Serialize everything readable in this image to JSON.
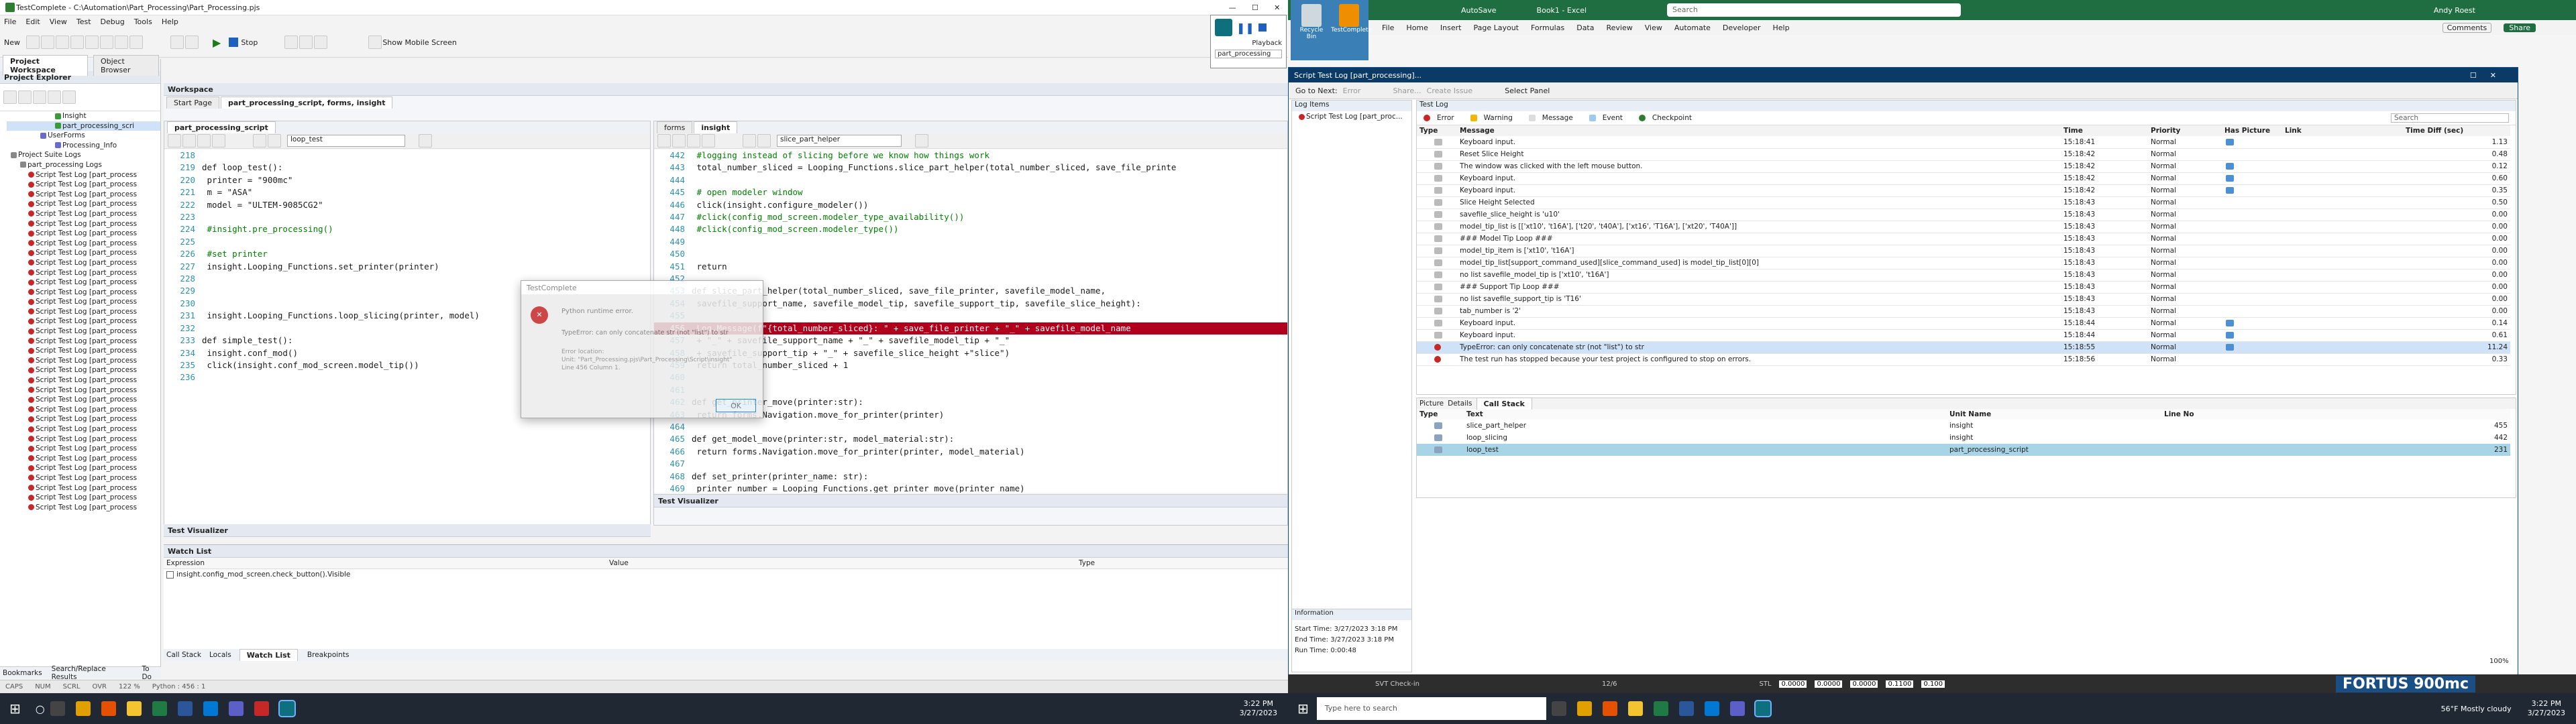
{
  "testcomplete": {
    "title": "TestComplete - C:\\Automation\\Part_Processing\\Part_Processing.pjs",
    "menu": [
      "File",
      "Edit",
      "View",
      "Test",
      "Debug",
      "Tools",
      "Help"
    ],
    "toolbar": {
      "new_label": "New",
      "stop_label": "Stop",
      "show_mobile_label": "Show Mobile Screen"
    },
    "project_explorer": {
      "tabs": [
        "Project Workspace",
        "Object Browser"
      ],
      "header": "Project Explorer",
      "tree": [
        "Insight",
        "part_processing_scri",
        "UserForms",
        "Processing_Info",
        "Project Suite Logs",
        "part_processing Logs"
      ],
      "log_items": [
        "Script Test Log [part_process",
        "Script Test Log [part_process",
        "Script Test Log [part_process",
        "Script Test Log [part_process",
        "Script Test Log [part_process",
        "Script Test Log [part_process",
        "Script Test Log [part_process",
        "Script Test Log [part_process",
        "Script Test Log [part_process",
        "Script Test Log [part_process",
        "Script Test Log [part_process",
        "Script Test Log [part_process",
        "Script Test Log [part_process",
        "Script Test Log [part_process",
        "Script Test Log [part_process",
        "Script Test Log [part_process",
        "Script Test Log [part_process",
        "Script Test Log [part_process",
        "Script Test Log [part_process",
        "Script Test Log [part_process",
        "Script Test Log [part_process",
        "Script Test Log [part_process",
        "Script Test Log [part_process",
        "Script Test Log [part_process",
        "Script Test Log [part_process",
        "Script Test Log [part_process",
        "Script Test Log [part_process",
        "Script Test Log [part_process",
        "Script Test Log [part_process",
        "Script Test Log [part_process",
        "Script Test Log [part_process",
        "Script Test Log [part_process",
        "Script Test Log [part_process",
        "Script Test Log [part_process",
        "Script Test Log [part_process"
      ],
      "bottom_tabs": [
        "Bookmarks",
        "Search/Replace Results",
        "To Do"
      ]
    },
    "workspace": {
      "header": "Workspace",
      "tabs": [
        "Start Page",
        "part_processing_script, forms, insight"
      ],
      "left_editor": {
        "tab": "part_processing_script",
        "routine": "loop_test",
        "lines": [
          {
            "n": "218",
            "t": ""
          },
          {
            "n": "219",
            "t": "def loop_test():"
          },
          {
            "n": "220",
            "t": "  printer = \"900mc\""
          },
          {
            "n": "221",
            "t": "  m = \"ASA\""
          },
          {
            "n": "222",
            "t": "  model = \"ULTEM-9085CG2\""
          },
          {
            "n": "223",
            "t": ""
          },
          {
            "n": "224",
            "t": "  #insight.pre_processing()"
          },
          {
            "n": "225",
            "t": ""
          },
          {
            "n": "226",
            "t": "  #set printer"
          },
          {
            "n": "227",
            "t": "  insight.Looping_Functions.set_printer(printer)"
          },
          {
            "n": "228",
            "t": ""
          },
          {
            "n": "229",
            "t": ""
          },
          {
            "n": "230",
            "t": ""
          },
          {
            "n": "231",
            "t": "  insight.Looping_Functions.loop_slicing(printer, model)"
          },
          {
            "n": "232",
            "t": ""
          },
          {
            "n": "233",
            "t": "def simple_test():"
          },
          {
            "n": "234",
            "t": "  insight.conf_mod()"
          },
          {
            "n": "235",
            "t": "  click(insight.conf_mod_screen.model_tip())"
          },
          {
            "n": "236",
            "t": ""
          }
        ]
      },
      "right_editor": {
        "tabs": [
          "forms",
          "insight"
        ],
        "routine": "slice_part_helper",
        "lines": [
          {
            "n": "442",
            "t": "      #logging instead of slicing before we know how things work",
            "c": "com"
          },
          {
            "n": "443",
            "t": "      total_number_sliced = Looping_Functions.slice_part_helper(total_number_sliced, save_file_printe",
            "c": ""
          },
          {
            "n": "444",
            "t": "",
            "c": ""
          },
          {
            "n": "445",
            "t": "      # open modeler window",
            "c": "com"
          },
          {
            "n": "446",
            "t": "      click(insight.configure_modeler())",
            "c": ""
          },
          {
            "n": "447",
            "t": "      #click(config_mod_screen.modeler_type_availability())",
            "c": "com"
          },
          {
            "n": "448",
            "t": "      #click(config_mod_screen.modeler_type())",
            "c": "com"
          },
          {
            "n": "449",
            "t": "",
            "c": ""
          },
          {
            "n": "450",
            "t": "",
            "c": ""
          },
          {
            "n": "451",
            "t": "    return",
            "c": ""
          },
          {
            "n": "452",
            "t": "",
            "c": ""
          },
          {
            "n": "453",
            "t": "def slice_part_helper(total_number_sliced, save_file_printer, savefile_model_name,",
            "c": ""
          },
          {
            "n": "454",
            "t": "    savefile_support_name, savefile_model_tip, savefile_support_tip, savefile_slice_height):",
            "c": ""
          },
          {
            "n": "455",
            "t": "",
            "c": ""
          },
          {
            "n": "456",
            "t": "    Log.Message(f\"{total_number_sliced}: \" + save_file_printer + \"_\" + savefile_model_name",
            "c": "err"
          },
          {
            "n": "457",
            "t": "      + \"_\" + savefile_support_name + \"_\" + savefile_model_tip + \"_\"",
            "c": ""
          },
          {
            "n": "458",
            "t": "      + savefile_support_tip + \"_\" + savefile_slice_height +\"slice\")",
            "c": ""
          },
          {
            "n": "459",
            "t": "    return total_number_sliced + 1",
            "c": ""
          },
          {
            "n": "460",
            "t": "",
            "c": ""
          },
          {
            "n": "461",
            "t": "",
            "c": ""
          },
          {
            "n": "462",
            "t": "def get_printer_move(printer:str):",
            "c": ""
          },
          {
            "n": "463",
            "t": "    return forms.Navigation.move_for_printer(printer)",
            "c": ""
          },
          {
            "n": "464",
            "t": "",
            "c": ""
          },
          {
            "n": "465",
            "t": "def get_model_move(printer:str, model_material:str):",
            "c": ""
          },
          {
            "n": "466",
            "t": "    return forms.Navigation.move_for_printer(printer, model_material)",
            "c": ""
          },
          {
            "n": "467",
            "t": "",
            "c": ""
          },
          {
            "n": "468",
            "t": "def set_printer(printer_name: str):",
            "c": ""
          },
          {
            "n": "469",
            "t": "    printer_number = Looping_Functions.get_printer_move(printer_name)",
            "c": ""
          }
        ]
      },
      "visualizer_label": "Test Visualizer"
    },
    "error_dialog": {
      "title": "TestComplete",
      "heading": "Python runtime error.",
      "message": "TypeError: can only concatenate str (not \"list\") to str",
      "details": "Error location:\nUnit: \"Part_Processing.pjs\\Part_Processing\\Script\\insight\"\nLine 456 Column 1.",
      "ok_label": "OK"
    },
    "watch_list": {
      "header": "Watch List",
      "columns": [
        "Expression",
        "Value",
        "Type"
      ],
      "rows": [
        {
          "expr": "insight.config_mod_screen.check_button().Visible",
          "value": "",
          "type": ""
        }
      ],
      "tabs": [
        "Call Stack",
        "Locals",
        "Watch List",
        "Breakpoints"
      ]
    },
    "statusbar": {
      "caps": "CAPS",
      "num": "NUM",
      "scrl": "SCRL",
      "ovr": "OVR",
      "zoom": "122 %",
      "python": "Python : 456 : 1"
    }
  },
  "playback": {
    "label": "Playback",
    "project": "part_processing"
  },
  "excel": {
    "title": "Book1 - Excel",
    "search_placeholder": "Search",
    "autosave": "AutoSave",
    "user": "Andy Roest",
    "menu": [
      "File",
      "Home",
      "Insert",
      "Page Layout",
      "Formulas",
      "Data",
      "Review",
      "View",
      "Automate",
      "Developer",
      "Help"
    ],
    "comments_label": "Comments",
    "share_label": "Share",
    "desktop_icons": [
      "Recycle Bin",
      "TestComplete"
    ],
    "fortus_text": "FORTUS 900mc"
  },
  "testlog": {
    "title": "Script Test Log [part_processing]...",
    "toolbar": {
      "goto_next": "Go to Next:",
      "error": "Error",
      "share": "Share...",
      "create_issue": "Create Issue",
      "select_panel": "Select Panel"
    },
    "items_header": "Log Items",
    "item": "Script Test Log [part_proc...",
    "testlog_header": "Test Log",
    "filters": [
      "Error",
      "Warning",
      "Message",
      "Event",
      "Checkpoint"
    ],
    "search_placeholder": "Search",
    "columns": [
      "Type",
      "Message",
      "Time",
      "Priority",
      "Has Picture",
      "Link",
      "Time Diff (sec)"
    ],
    "rows": [
      {
        "msg": "Keyboard input.",
        "time": "15:18:41",
        "pri": "Normal",
        "pic": true,
        "diff": "1.13",
        "err": false
      },
      {
        "msg": "Reset Slice Height",
        "time": "15:18:42",
        "pri": "Normal",
        "pic": false,
        "diff": "0.48",
        "err": false
      },
      {
        "msg": "The window was clicked with the left mouse button.",
        "time": "15:18:42",
        "pri": "Normal",
        "pic": true,
        "diff": "0.12",
        "err": false
      },
      {
        "msg": "Keyboard input.",
        "time": "15:18:42",
        "pri": "Normal",
        "pic": true,
        "diff": "0.60",
        "err": false
      },
      {
        "msg": "Keyboard input.",
        "time": "15:18:42",
        "pri": "Normal",
        "pic": true,
        "diff": "0.35",
        "err": false
      },
      {
        "msg": "Slice Height Selected",
        "time": "15:18:43",
        "pri": "Normal",
        "pic": false,
        "diff": "0.50",
        "err": false
      },
      {
        "msg": "savefile_slice_height is 'u10'",
        "time": "15:18:43",
        "pri": "Normal",
        "pic": false,
        "diff": "0.00",
        "err": false
      },
      {
        "msg": "model_tip_list is [['xt10', 't16A'], ['t20', 't40A'], ['xt16', 'T16A'], ['xt20', 'T40A']]",
        "time": "15:18:43",
        "pri": "Normal",
        "pic": false,
        "diff": "0.00",
        "err": false
      },
      {
        "msg": "### Model Tip Loop ###",
        "time": "15:18:43",
        "pri": "Normal",
        "pic": false,
        "diff": "0.00",
        "err": false
      },
      {
        "msg": "model_tip_item is ['xt10', 't16A']",
        "time": "15:18:43",
        "pri": "Normal",
        "pic": false,
        "diff": "0.00",
        "err": false
      },
      {
        "msg": "model_tip_list[support_command_used][slice_command_used] is model_tip_list[0][0]",
        "time": "15:18:43",
        "pri": "Normal",
        "pic": false,
        "diff": "0.00",
        "err": false
      },
      {
        "msg": "no list savefile_model_tip is ['xt10', 't16A']",
        "time": "15:18:43",
        "pri": "Normal",
        "pic": false,
        "diff": "0.00",
        "err": false
      },
      {
        "msg": "### Support Tip Loop ###",
        "time": "15:18:43",
        "pri": "Normal",
        "pic": false,
        "diff": "0.00",
        "err": false
      },
      {
        "msg": "no list savefile_support_tip is 'T16'",
        "time": "15:18:43",
        "pri": "Normal",
        "pic": false,
        "diff": "0.00",
        "err": false
      },
      {
        "msg": "tab_number is '2'",
        "time": "15:18:43",
        "pri": "Normal",
        "pic": false,
        "diff": "0.00",
        "err": false
      },
      {
        "msg": "Keyboard input.",
        "time": "15:18:44",
        "pri": "Normal",
        "pic": true,
        "diff": "0.14",
        "err": false
      },
      {
        "msg": "Keyboard input.",
        "time": "15:18:44",
        "pri": "Normal",
        "pic": true,
        "diff": "0.61",
        "err": false
      },
      {
        "msg": "TypeError: can only concatenate str (not \"list\") to str",
        "time": "15:18:55",
        "pri": "Normal",
        "pic": true,
        "diff": "11.24",
        "err": true
      },
      {
        "msg": "The test run has stopped because your test project is configured to stop on errors.",
        "time": "15:18:56",
        "pri": "Normal",
        "pic": false,
        "diff": "0.33",
        "err": true
      }
    ],
    "detail_tabs": [
      "Picture",
      "Details",
      "Call Stack"
    ],
    "stack_columns": [
      "Type",
      "Text",
      "Unit Name",
      "Line No"
    ],
    "stack_rows": [
      {
        "text": "slice_part_helper",
        "unit": "insight",
        "line": "455"
      },
      {
        "text": "loop_slicing",
        "unit": "insight",
        "line": "442"
      },
      {
        "text": "loop_test",
        "unit": "part_processing_script",
        "line": "231"
      }
    ],
    "info_header": "Information",
    "start_time": "Start Time: 3/27/2023 3:18 PM",
    "end_time": "End Time: 3/27/2023 3:18 PM",
    "run_time": "Run Time: 0:00:48",
    "zoom": "100%"
  },
  "taskbars": {
    "left_time": "3:22 PM",
    "left_date": "3/27/2023",
    "right_time": "3:22 PM",
    "right_date": "3/27/2023",
    "search_placeholder": "Type here to search",
    "weather": "56°F  Mostly cloudy",
    "svt_label": "SVT Check-in",
    "page_count": "12/6",
    "coords": {
      "stl": "STL",
      "x": "0.0000",
      "y": "0.0000",
      "z": "0.0000",
      "a": "0.1100",
      "b": "0.100",
      "label_x": "X",
      "label_y": "Y",
      "label_z": "Z",
      "label_d2": "d2"
    }
  },
  "colors": {
    "error_red": "#b0001b",
    "selection": "#cfe2f7",
    "accent": "#0078d4"
  }
}
